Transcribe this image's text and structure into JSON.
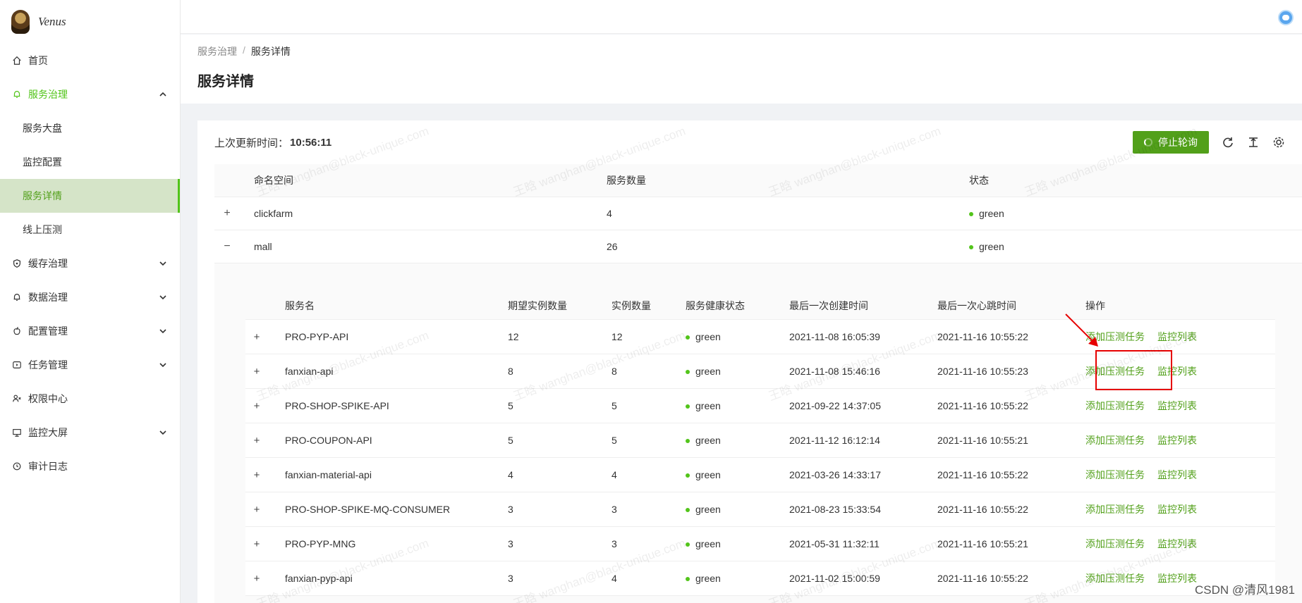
{
  "app": {
    "name": "Venus"
  },
  "sidebar": {
    "items": [
      {
        "label": "首页",
        "icon": "home-icon"
      },
      {
        "label": "服务治理",
        "icon": "bell-icon",
        "expanded": true,
        "children": [
          {
            "label": "服务大盘"
          },
          {
            "label": "监控配置"
          },
          {
            "label": "服务详情",
            "selected": true
          },
          {
            "label": "线上压测"
          }
        ]
      },
      {
        "label": "缓存治理",
        "icon": "shield-icon"
      },
      {
        "label": "数据治理",
        "icon": "bell-icon"
      },
      {
        "label": "配置管理",
        "icon": "apple-icon"
      },
      {
        "label": "任务管理",
        "icon": "play-icon"
      },
      {
        "label": "权限中心",
        "icon": "users-icon"
      },
      {
        "label": "监控大屏",
        "icon": "monitor-icon"
      },
      {
        "label": "审计日志",
        "icon": "clock-icon"
      }
    ]
  },
  "breadcrumb": {
    "parent": "服务治理",
    "separator": "/",
    "current": "服务详情"
  },
  "page": {
    "title": "服务详情"
  },
  "toolbar": {
    "update_label": "上次更新时间：",
    "update_time": "10:56:11",
    "stop_label": "停止轮询"
  },
  "outer_table": {
    "headers": [
      "命名空间",
      "服务数量",
      "状态"
    ],
    "rows": [
      {
        "expander": "+",
        "namespace": "clickfarm",
        "count": "4",
        "status": "green"
      },
      {
        "expander": "−",
        "namespace": "mall",
        "count": "26",
        "status": "green"
      }
    ]
  },
  "inner_table": {
    "headers": [
      "服务名",
      "期望实例数量",
      "实例数量",
      "服务健康状态",
      "最后一次创建时间",
      "最后一次心跳时间",
      "操作"
    ],
    "action_add": "添加压测任务",
    "action_monitor": "监控列表",
    "rows": [
      {
        "name": "PRO-PYP-API",
        "expected": "12",
        "actual": "12",
        "health": "green",
        "created": "2021-11-08 16:05:39",
        "heartbeat": "2021-11-16 10:55:22"
      },
      {
        "name": "fanxian-api",
        "expected": "8",
        "actual": "8",
        "health": "green",
        "created": "2021-11-08 15:46:16",
        "heartbeat": "2021-11-16 10:55:23"
      },
      {
        "name": "PRO-SHOP-SPIKE-API",
        "expected": "5",
        "actual": "5",
        "health": "green",
        "created": "2021-09-22 14:37:05",
        "heartbeat": "2021-11-16 10:55:22"
      },
      {
        "name": "PRO-COUPON-API",
        "expected": "5",
        "actual": "5",
        "health": "green",
        "created": "2021-11-12 16:12:14",
        "heartbeat": "2021-11-16 10:55:21"
      },
      {
        "name": "fanxian-material-api",
        "expected": "4",
        "actual": "4",
        "health": "green",
        "created": "2021-03-26 14:33:17",
        "heartbeat": "2021-11-16 10:55:22"
      },
      {
        "name": "PRO-SHOP-SPIKE-MQ-CONSUMER",
        "expected": "3",
        "actual": "3",
        "health": "green",
        "created": "2021-08-23 15:33:54",
        "heartbeat": "2021-11-16 10:55:22"
      },
      {
        "name": "PRO-PYP-MNG",
        "expected": "3",
        "actual": "3",
        "health": "green",
        "created": "2021-05-31 11:32:11",
        "heartbeat": "2021-11-16 10:55:21"
      },
      {
        "name": "fanxian-pyp-api",
        "expected": "3",
        "actual": "4",
        "health": "green",
        "created": "2021-11-02 15:00:59",
        "heartbeat": "2021-11-16 10:55:22"
      }
    ]
  },
  "watermark": "王晗 wanghan@black-unique.com",
  "footer_credit": "CSDN @清风1981",
  "colors": {
    "accent": "#52c41a",
    "button": "#52a01a",
    "highlight": "#e60000"
  }
}
